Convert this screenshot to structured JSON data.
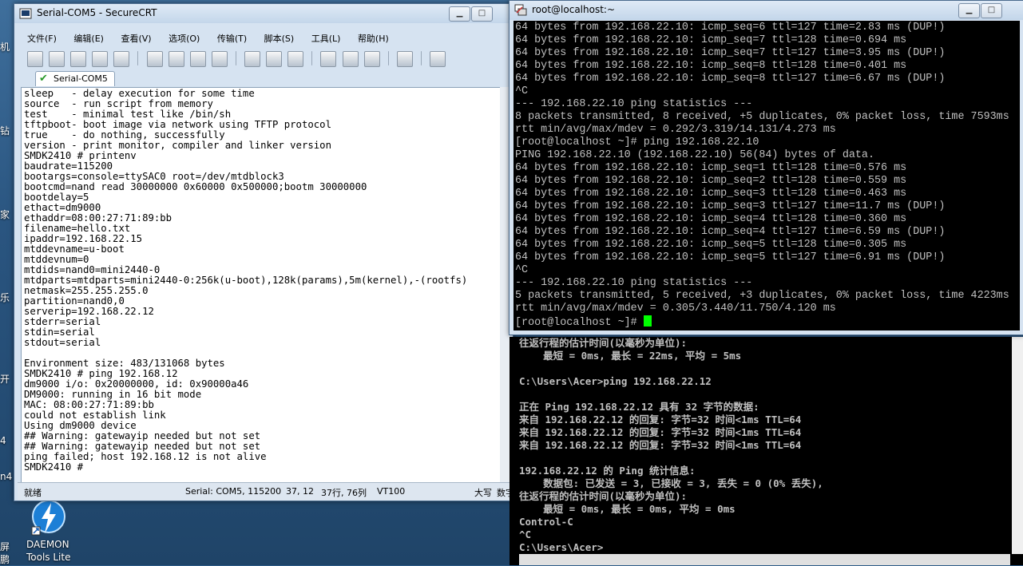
{
  "desktop": {
    "left_edge_labels": [
      "机",
      "钻",
      "家",
      "乐",
      "开",
      "4",
      "n4",
      "屏",
      "鹏"
    ],
    "daemon_tools": {
      "label_line1": "DAEMON",
      "label_line2": "Tools Lite"
    }
  },
  "securecrt": {
    "title": "Serial-COM5 - SecureCRT",
    "menu": [
      "文件(F)",
      "编辑(E)",
      "查看(V)",
      "选项(O)",
      "传输(T)",
      "脚本(S)",
      "工具(L)",
      "帮助(H)"
    ],
    "tab_label": "Serial-COM5",
    "terminal_lines": [
      "sleep   - delay execution for some time",
      "source  - run script from memory",
      "test    - minimal test like /bin/sh",
      "tftpboot- boot image via network using TFTP protocol",
      "true    - do nothing, successfully",
      "version - print monitor, compiler and linker version",
      "SMDK2410 # printenv",
      "baudrate=115200",
      "bootargs=console=ttySAC0 root=/dev/mtdblock3",
      "bootcmd=nand read 30000000 0x60000 0x500000;bootm 30000000",
      "bootdelay=5",
      "ethact=dm9000",
      "ethaddr=08:00:27:71:89:bb",
      "filename=hello.txt",
      "ipaddr=192.168.22.15",
      "mtddevname=u-boot",
      "mtddevnum=0",
      "mtdids=nand0=mini2440-0",
      "mtdparts=mtdparts=mini2440-0:256k(u-boot),128k(params),5m(kernel),-(rootfs)",
      "netmask=255.255.255.0",
      "partition=nand0,0",
      "serverip=192.168.22.12",
      "stderr=serial",
      "stdin=serial",
      "stdout=serial",
      "",
      "Environment size: 483/131068 bytes",
      "SMDK2410 # ping 192.168.12",
      "dm9000 i/o: 0x20000000, id: 0x90000a46",
      "DM9000: running in 16 bit mode",
      "MAC: 08:00:27:71:89:bb",
      "could not establish link",
      "Using dm9000 device",
      "## Warning: gatewayip needed but not set",
      "## Warning: gatewayip needed but not set",
      "ping failed; host 192.168.12 is not alive",
      "SMDK2410 #"
    ],
    "status": {
      "ready": "就绪",
      "serial": "Serial: COM5, 115200",
      "cursor": "37,  12",
      "rowcol": "37行, 76列",
      "emulation": "VT100",
      "caps": "大写",
      "num": "数字"
    }
  },
  "putty": {
    "title": "root@localhost:~",
    "terminal_lines": [
      "64 bytes from 192.168.22.10: icmp_seq=6 ttl=127 time=2.83 ms (DUP!)",
      "64 bytes from 192.168.22.10: icmp_seq=7 ttl=128 time=0.694 ms",
      "64 bytes from 192.168.22.10: icmp_seq=7 ttl=127 time=3.95 ms (DUP!)",
      "64 bytes from 192.168.22.10: icmp_seq=8 ttl=128 time=0.401 ms",
      "64 bytes from 192.168.22.10: icmp_seq=8 ttl=127 time=6.67 ms (DUP!)",
      "^C",
      "--- 192.168.22.10 ping statistics ---",
      "8 packets transmitted, 8 received, +5 duplicates, 0% packet loss, time 7593ms",
      "rtt min/avg/max/mdev = 0.292/3.319/14.131/4.273 ms",
      "[root@localhost ~]# ping 192.168.22.10",
      "PING 192.168.22.10 (192.168.22.10) 56(84) bytes of data.",
      "64 bytes from 192.168.22.10: icmp_seq=1 ttl=128 time=0.576 ms",
      "64 bytes from 192.168.22.10: icmp_seq=2 ttl=128 time=0.559 ms",
      "64 bytes from 192.168.22.10: icmp_seq=3 ttl=128 time=0.463 ms",
      "64 bytes from 192.168.22.10: icmp_seq=3 ttl=127 time=11.7 ms (DUP!)",
      "64 bytes from 192.168.22.10: icmp_seq=4 ttl=128 time=0.360 ms",
      "64 bytes from 192.168.22.10: icmp_seq=4 ttl=127 time=6.59 ms (DUP!)",
      "64 bytes from 192.168.22.10: icmp_seq=5 ttl=128 time=0.305 ms",
      "64 bytes from 192.168.22.10: icmp_seq=5 ttl=127 time=6.91 ms (DUP!)",
      "^C",
      "--- 192.168.22.10 ping statistics ---",
      "5 packets transmitted, 5 received, +3 duplicates, 0% packet loss, time 4223ms",
      "rtt min/avg/max/mdev = 0.305/3.440/11.750/4.120 ms"
    ],
    "prompt": "[root@localhost ~]# "
  },
  "cmd": {
    "terminal_lines": [
      "往返行程的估计时间(以毫秒为单位):",
      "    最短 = 0ms, 最长 = 22ms, 平均 = 5ms",
      "",
      "C:\\Users\\Acer>ping 192.168.22.12",
      "",
      "正在 Ping 192.168.22.12 具有 32 字节的数据:",
      "来自 192.168.22.12 的回复: 字节=32 时间<1ms TTL=64",
      "来自 192.168.22.12 的回复: 字节=32 时间<1ms TTL=64",
      "来自 192.168.22.12 的回复: 字节=32 时间<1ms TTL=64",
      "",
      "192.168.22.12 的 Ping 统计信息:",
      "    数据包: 已发送 = 3, 已接收 = 3, 丢失 = 0 (0% 丢失),",
      "往返行程的估计时间(以毫秒为单位):",
      "    最短 = 0ms, 最长 = 0ms, 平均 = 0ms",
      "Control-C",
      "^C",
      "C:\\Users\\Acer>"
    ]
  }
}
